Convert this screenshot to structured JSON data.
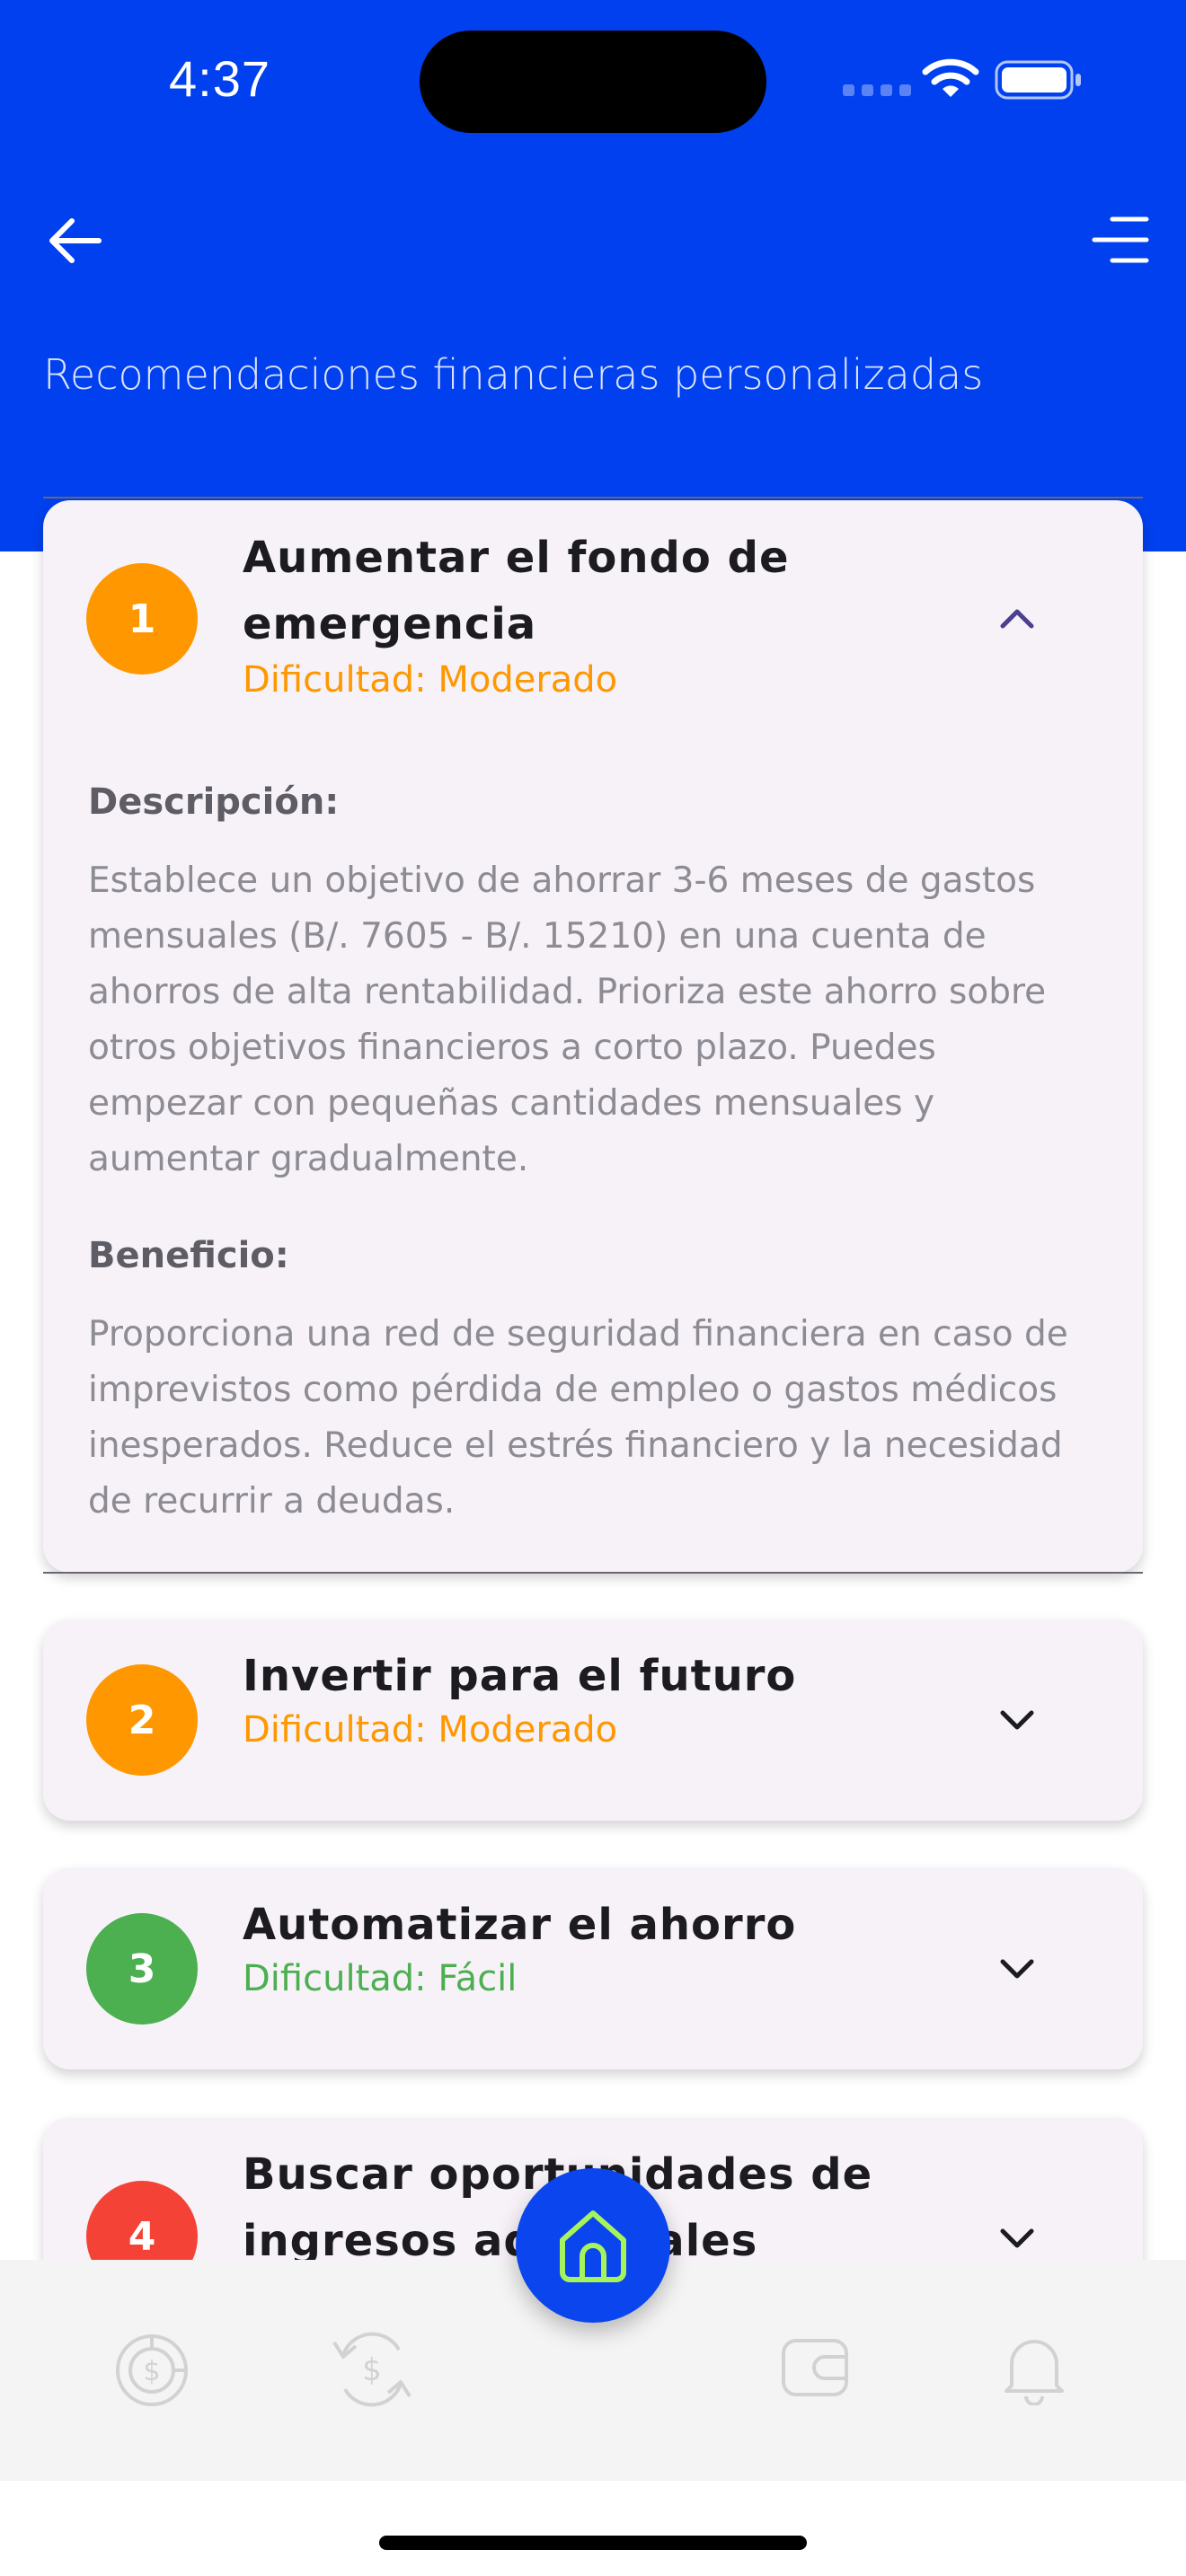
{
  "status_bar": {
    "time": "4:37"
  },
  "header": {
    "title": "Recomendaciones financieras personalizadas",
    "back_icon": "arrow-left-icon",
    "menu_icon": "menu-lines-icon",
    "background": "#0040ee"
  },
  "section_labels": {
    "description": "Descripción:",
    "benefit": "Beneficio:"
  },
  "recommendations": [
    {
      "number": "1",
      "title_lines": [
        "Aumentar el fondo de",
        "emergencia"
      ],
      "difficulty": "Dificultad: Moderado",
      "color": "#ff9800",
      "expanded": true,
      "description_lines": [
        "Establece un objetivo de ahorrar 3-6 meses de gastos",
        "mensuales (B/. 7605 - B/. 15210) en una cuenta de",
        "ahorros de alta rentabilidad.  Prioriza este ahorro sobre",
        "otros objetivos financieros a corto plazo.  Puedes",
        "empezar con pequeñas cantidades mensuales y",
        "aumentar gradualmente."
      ],
      "benefit_lines": [
        "Proporciona una red de seguridad financiera en caso de",
        "imprevistos como pérdida de empleo o gastos médicos",
        "inesperados.  Reduce el estrés financiero y la necesidad",
        "de recurrir a deudas."
      ]
    },
    {
      "number": "2",
      "title": "Invertir para el futuro",
      "difficulty": "Dificultad: Moderado",
      "color": "#ff9800",
      "expanded": false
    },
    {
      "number": "3",
      "title": "Automatizar el ahorro",
      "difficulty": "Dificultad: Fácil",
      "color": "#4caf50",
      "expanded": false
    },
    {
      "number": "4",
      "title_lines": [
        "Buscar oportunidades de",
        "ingresos adicionales"
      ],
      "difficulty": "",
      "color": "#f44336",
      "expanded": false
    }
  ],
  "bottom_nav": {
    "items": [
      "coin-chart-icon",
      "money-exchange-icon",
      "home-icon",
      "wallet-icon",
      "bell-icon"
    ],
    "home_accent": "#a6f35b"
  }
}
